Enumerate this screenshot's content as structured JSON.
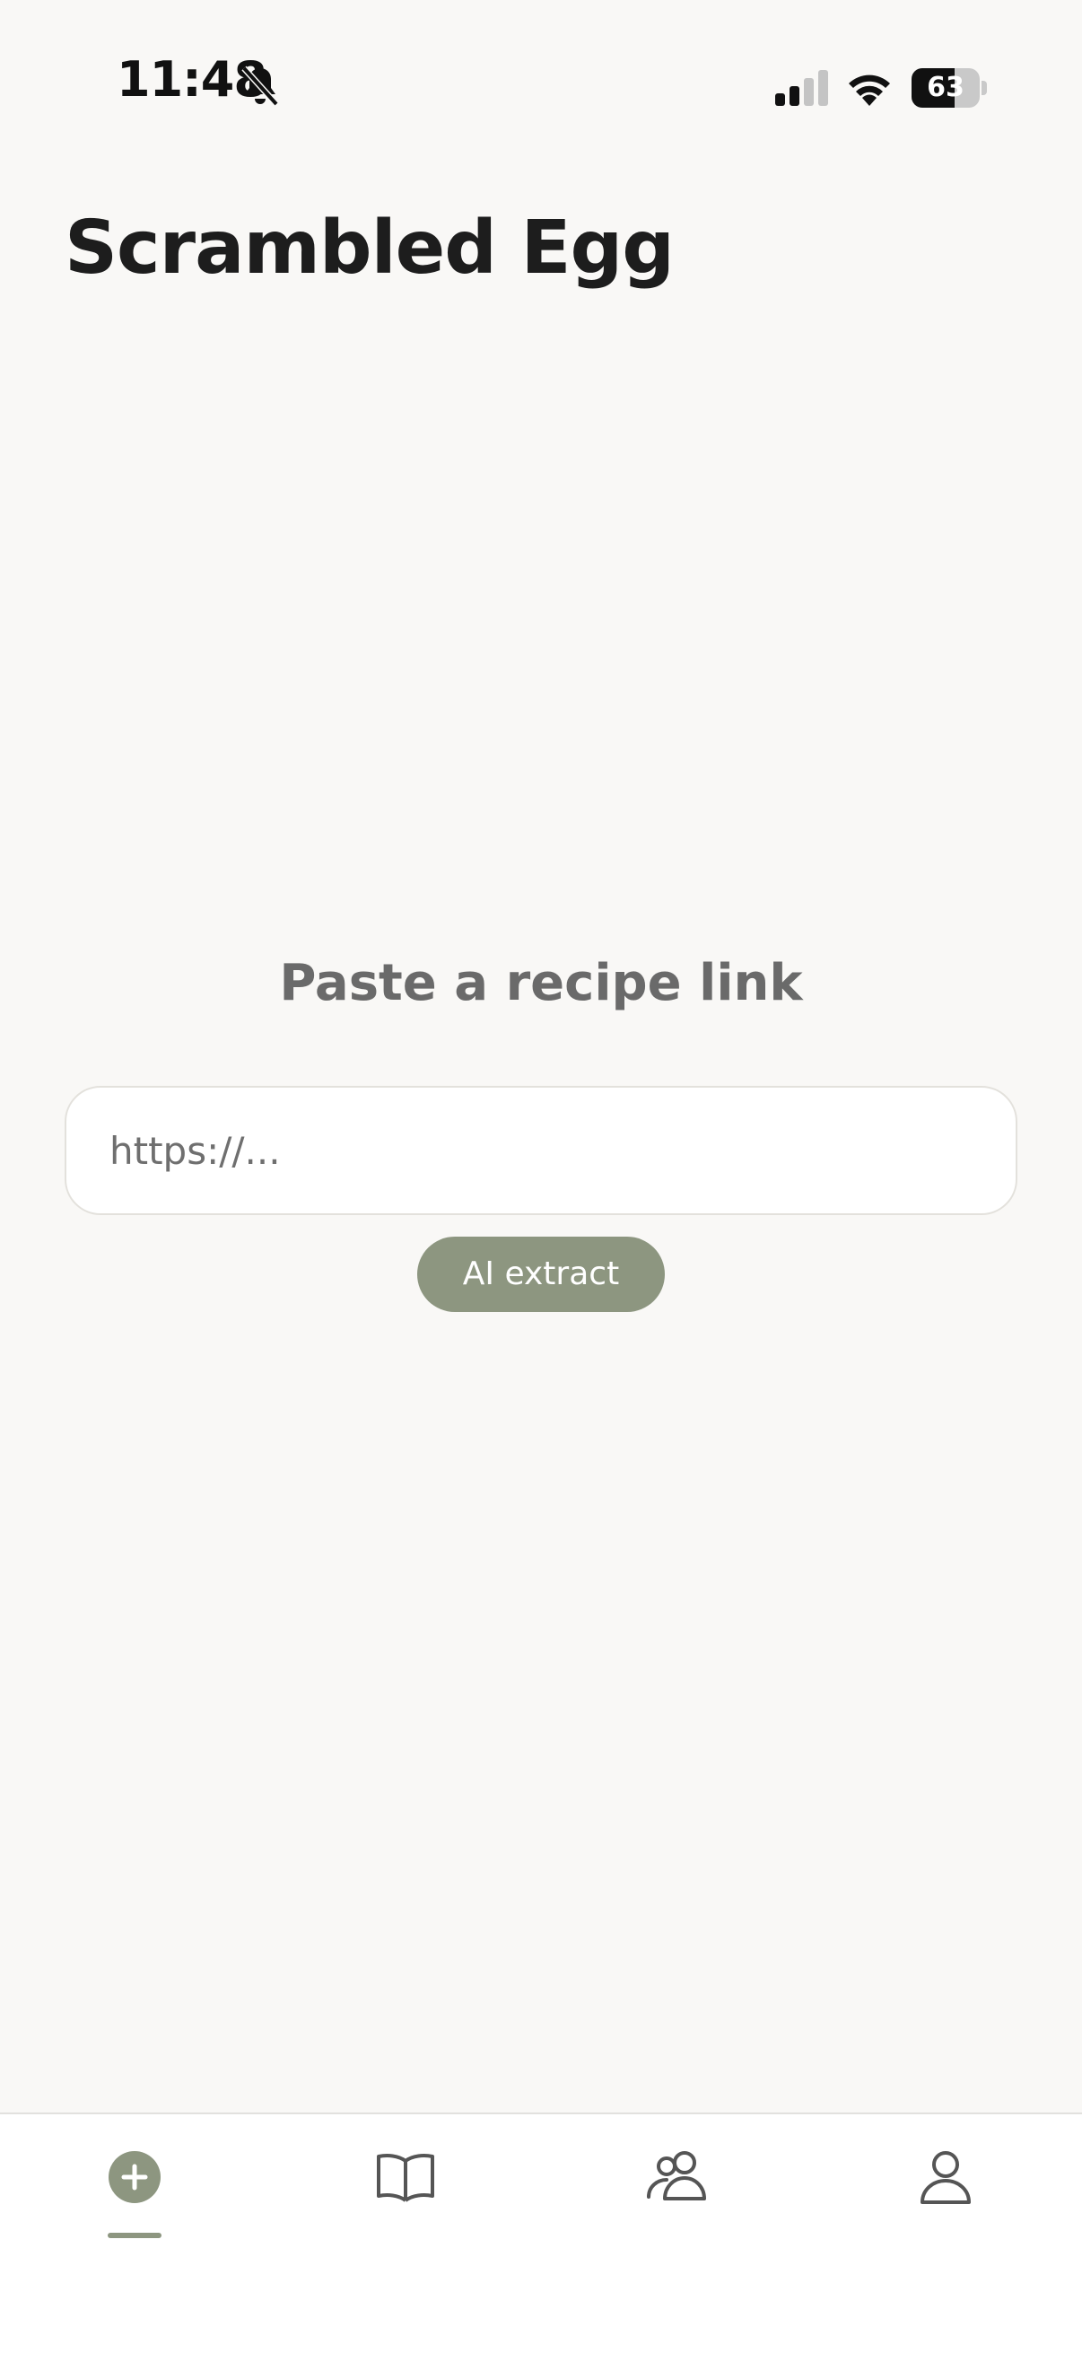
{
  "status_bar": {
    "time": "11:48",
    "battery_level": "63",
    "battery_fraction": 0.63
  },
  "header": {
    "title": "Scrambled Egg"
  },
  "main": {
    "prompt": "Paste a recipe link",
    "url_input": {
      "placeholder": "https://...",
      "value": ""
    },
    "extract_button": {
      "label": "AI extract"
    }
  },
  "tabbar": {
    "tabs": [
      {
        "icon": "add-circle-icon",
        "selected": true
      },
      {
        "icon": "book-icon",
        "selected": false
      },
      {
        "icon": "people-icon",
        "selected": false
      },
      {
        "icon": "profile-icon",
        "selected": false
      }
    ]
  },
  "colors": {
    "background": "#f9f8f6",
    "accent": "#8d9680",
    "title": "#1d1d1d",
    "prompt": "#6a6a6a"
  }
}
